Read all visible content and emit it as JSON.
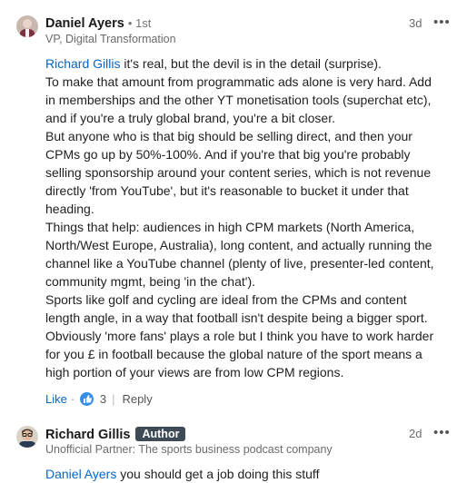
{
  "comment1": {
    "author": "Daniel Ayers",
    "degree": "1st",
    "headline": "VP, Digital Transformation",
    "time": "3d",
    "more": "•••",
    "mention": "Richard Gillis",
    "lines": [
      " it's real, but the devil is in the detail (surprise).",
      "To make that amount from programmatic ads alone is very hard. Add",
      "in memberships and the other YT monetisation tools (superchat etc),",
      "and if you're a truly global brand, you're a bit closer.",
      "But anyone who is that big should be selling direct, and then your",
      "CPMs go up by 50%-100%. And if you're that big you're probably",
      "selling sponsorship around your content series, which is not revenue",
      "directly 'from YouTube', but it's reasonable to bucket it under that",
      "heading.",
      "Things that help: audiences in high CPM markets (North America,",
      "North/West Europe, Australia), long content, and actually running the",
      "channel like a YouTube channel (plenty of live, presenter-led content,",
      "community mgmt, being 'in the chat').",
      "Sports like golf and cycling are ideal from the CPMs and content",
      "length angle, in a way that football isn't despite being a bigger sport.",
      "Obviously 'more fans' plays a role but I think you have to work harder",
      "for you £ in football because the global nature of the sport means a",
      "high portion of your views are from low CPM regions."
    ],
    "like_label": "Like",
    "reaction_count": "3",
    "reply_label": "Reply"
  },
  "comment2": {
    "author": "Richard Gillis",
    "badge": "Author",
    "headline": "Unofficial Partner: The sports business podcast company",
    "time": "2d",
    "more": "•••",
    "mention": "Daniel Ayers",
    "text": " you should get a job doing this stuff"
  }
}
